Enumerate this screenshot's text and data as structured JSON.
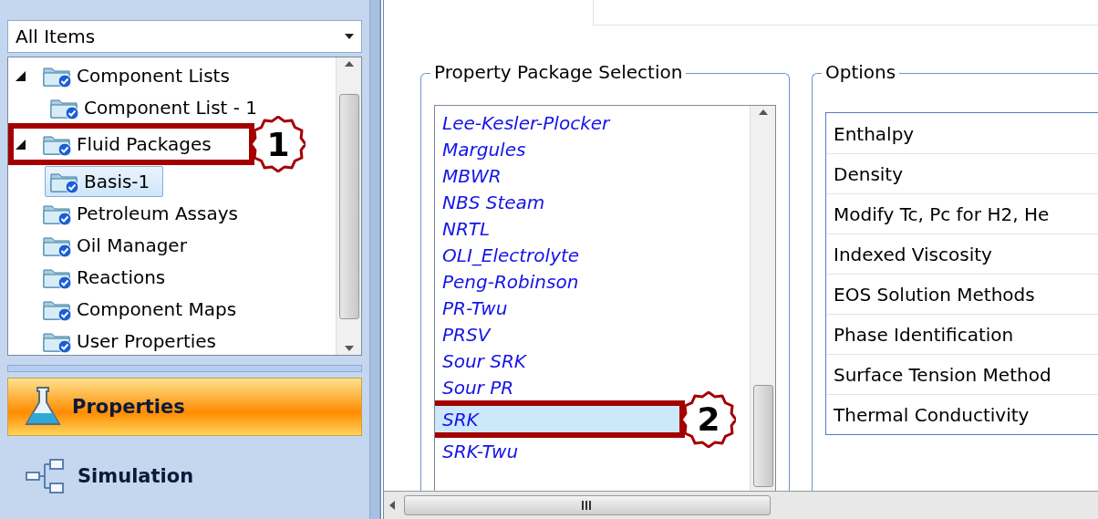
{
  "filter": {
    "value": "All Items"
  },
  "tree": [
    {
      "label": "Component Lists",
      "expanded": true,
      "selected": false,
      "children": [
        {
          "label": "Component List - 1",
          "selected": false
        }
      ]
    },
    {
      "label": "Fluid Packages",
      "expanded": true,
      "selected": false,
      "callout": "1",
      "children": [
        {
          "label": "Basis-1",
          "selected": true
        }
      ]
    },
    {
      "label": "Petroleum Assays",
      "selected": false
    },
    {
      "label": "Oil Manager",
      "selected": false
    },
    {
      "label": "Reactions",
      "selected": false
    },
    {
      "label": "Component Maps",
      "selected": false
    },
    {
      "label": "User Properties",
      "selected": false
    }
  ],
  "nav": [
    {
      "label": "Properties",
      "kind": "flask",
      "selected": true
    },
    {
      "label": "Simulation",
      "kind": "flowsheet",
      "selected": false
    }
  ],
  "property_package": {
    "title": "Property Package Selection",
    "items": [
      {
        "label": "Lee-Kesler-Plocker",
        "selected": false
      },
      {
        "label": "Margules",
        "selected": false
      },
      {
        "label": "MBWR",
        "selected": false
      },
      {
        "label": "NBS Steam",
        "selected": false
      },
      {
        "label": "NRTL",
        "selected": false
      },
      {
        "label": "OLI_Electrolyte",
        "selected": false
      },
      {
        "label": "Peng-Robinson",
        "selected": false
      },
      {
        "label": "PR-Twu",
        "selected": false
      },
      {
        "label": "PRSV",
        "selected": false
      },
      {
        "label": "Sour SRK",
        "selected": false
      },
      {
        "label": "Sour PR",
        "selected": false
      },
      {
        "label": "SRK",
        "selected": true,
        "callout": "2"
      },
      {
        "label": "SRK-Twu",
        "selected": false
      }
    ]
  },
  "options": {
    "title": "Options",
    "items": [
      "Enthalpy",
      "Density",
      "Modify Tc, Pc for H2, He",
      "Indexed Viscosity",
      "EOS Solution Methods",
      "Phase Identification",
      "Surface Tension Method",
      "Thermal Conductivity"
    ]
  }
}
